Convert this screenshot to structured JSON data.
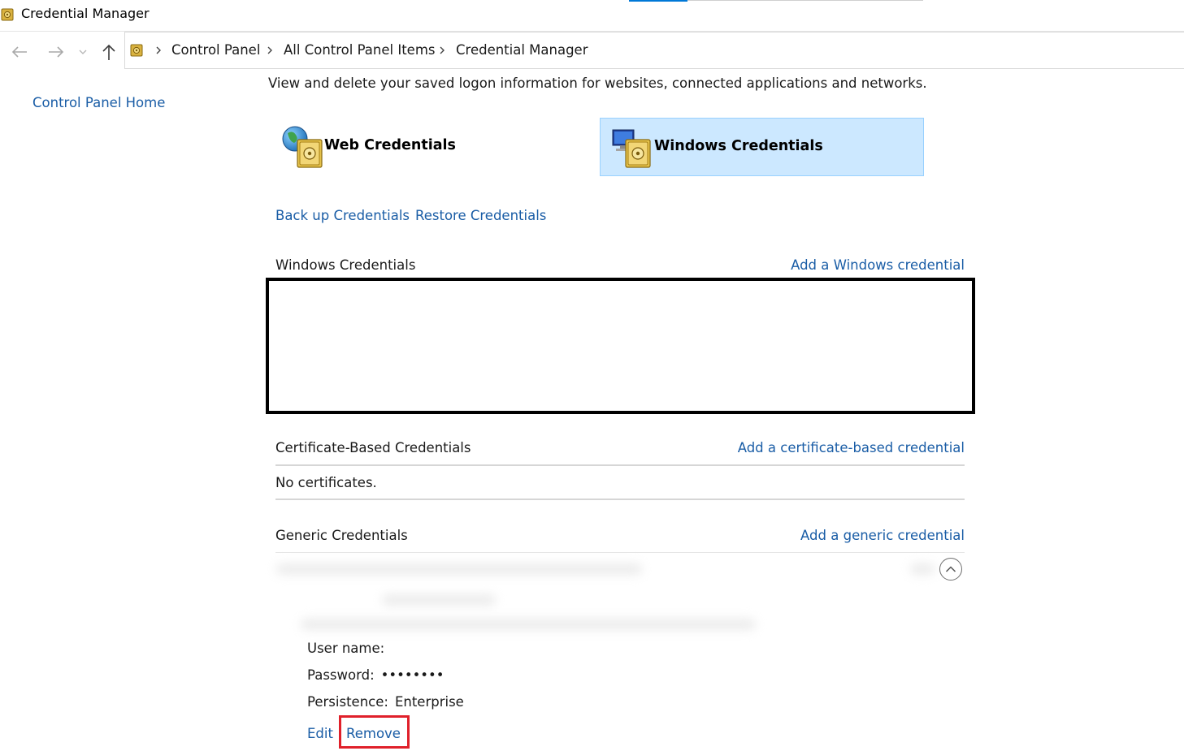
{
  "window": {
    "title": "Credential Manager",
    "accent_color": "#0078d7"
  },
  "icons": {
    "app": "credential-vault-icon",
    "back": "arrow-left-icon",
    "forward": "arrow-right-icon",
    "recent": "chevron-down-icon",
    "up": "arrow-up-icon",
    "breadcrumb_separator": "chevron-right-icon",
    "web_tile": "globe-vault-icon",
    "windows_tile": "computer-vault-icon",
    "expand": "chevron-up-circle-icon"
  },
  "breadcrumb": [
    "Control Panel",
    "All Control Panel Items",
    "Credential Manager"
  ],
  "left_pane": {
    "home_link": "Control Panel Home"
  },
  "main": {
    "description": "View and delete your saved logon information for websites, connected applications and networks.",
    "tiles": [
      {
        "label": "Web Credentials",
        "selected": false
      },
      {
        "label": "Windows Credentials",
        "selected": true,
        "color": "#cce8ff"
      }
    ],
    "actions": {
      "backup": "Back up Credentials",
      "restore": "Restore Credentials"
    },
    "windows_credentials": {
      "title": "Windows Credentials",
      "add_link": "Add a Windows credential"
    },
    "certificate_credentials": {
      "title": "Certificate-Based Credentials",
      "add_link": "Add a certificate-based credential",
      "empty_text": "No certificates."
    },
    "generic_credentials": {
      "title": "Generic Credentials",
      "add_link": "Add a generic credential",
      "entry": {
        "username_label": "User name:",
        "password_label": "Password:",
        "password_value": "••••••••",
        "persistence_label": "Persistence:",
        "persistence_value": "Enterprise",
        "edit_link": "Edit",
        "remove_link": "Remove"
      }
    }
  },
  "colors": {
    "link": "#1a5da6",
    "selected_tile": "#cce8ff",
    "highlight": "#e0202a"
  }
}
